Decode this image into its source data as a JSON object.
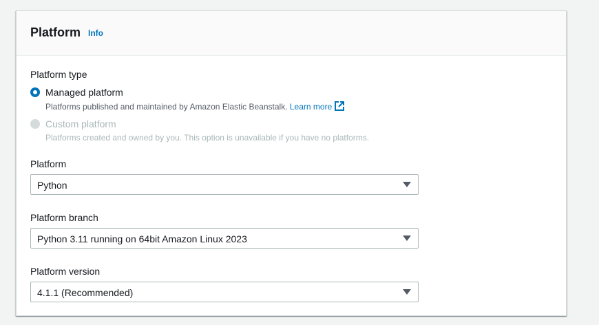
{
  "section": {
    "title": "Platform",
    "info_label": "Info"
  },
  "platform_type": {
    "label": "Platform type",
    "options": [
      {
        "label": "Managed platform",
        "description": "Platforms published and maintained by Amazon Elastic Beanstalk.",
        "link": "Learn more",
        "checked": true,
        "disabled": false
      },
      {
        "label": "Custom platform",
        "description": "Platforms created and owned by you. This option is unavailable if you have no platforms.",
        "checked": false,
        "disabled": true
      }
    ]
  },
  "platform": {
    "label": "Platform",
    "value": "Python"
  },
  "platform_branch": {
    "label": "Platform branch",
    "value": "Python 3.11 running on 64bit Amazon Linux 2023"
  },
  "platform_version": {
    "label": "Platform version",
    "value": "4.1.1 (Recommended)"
  },
  "colors": {
    "accent": "#0073bb",
    "text": "#16191f",
    "muted": "#545b64",
    "disabled": "#aab7b8",
    "background": "#f2f3f3"
  }
}
